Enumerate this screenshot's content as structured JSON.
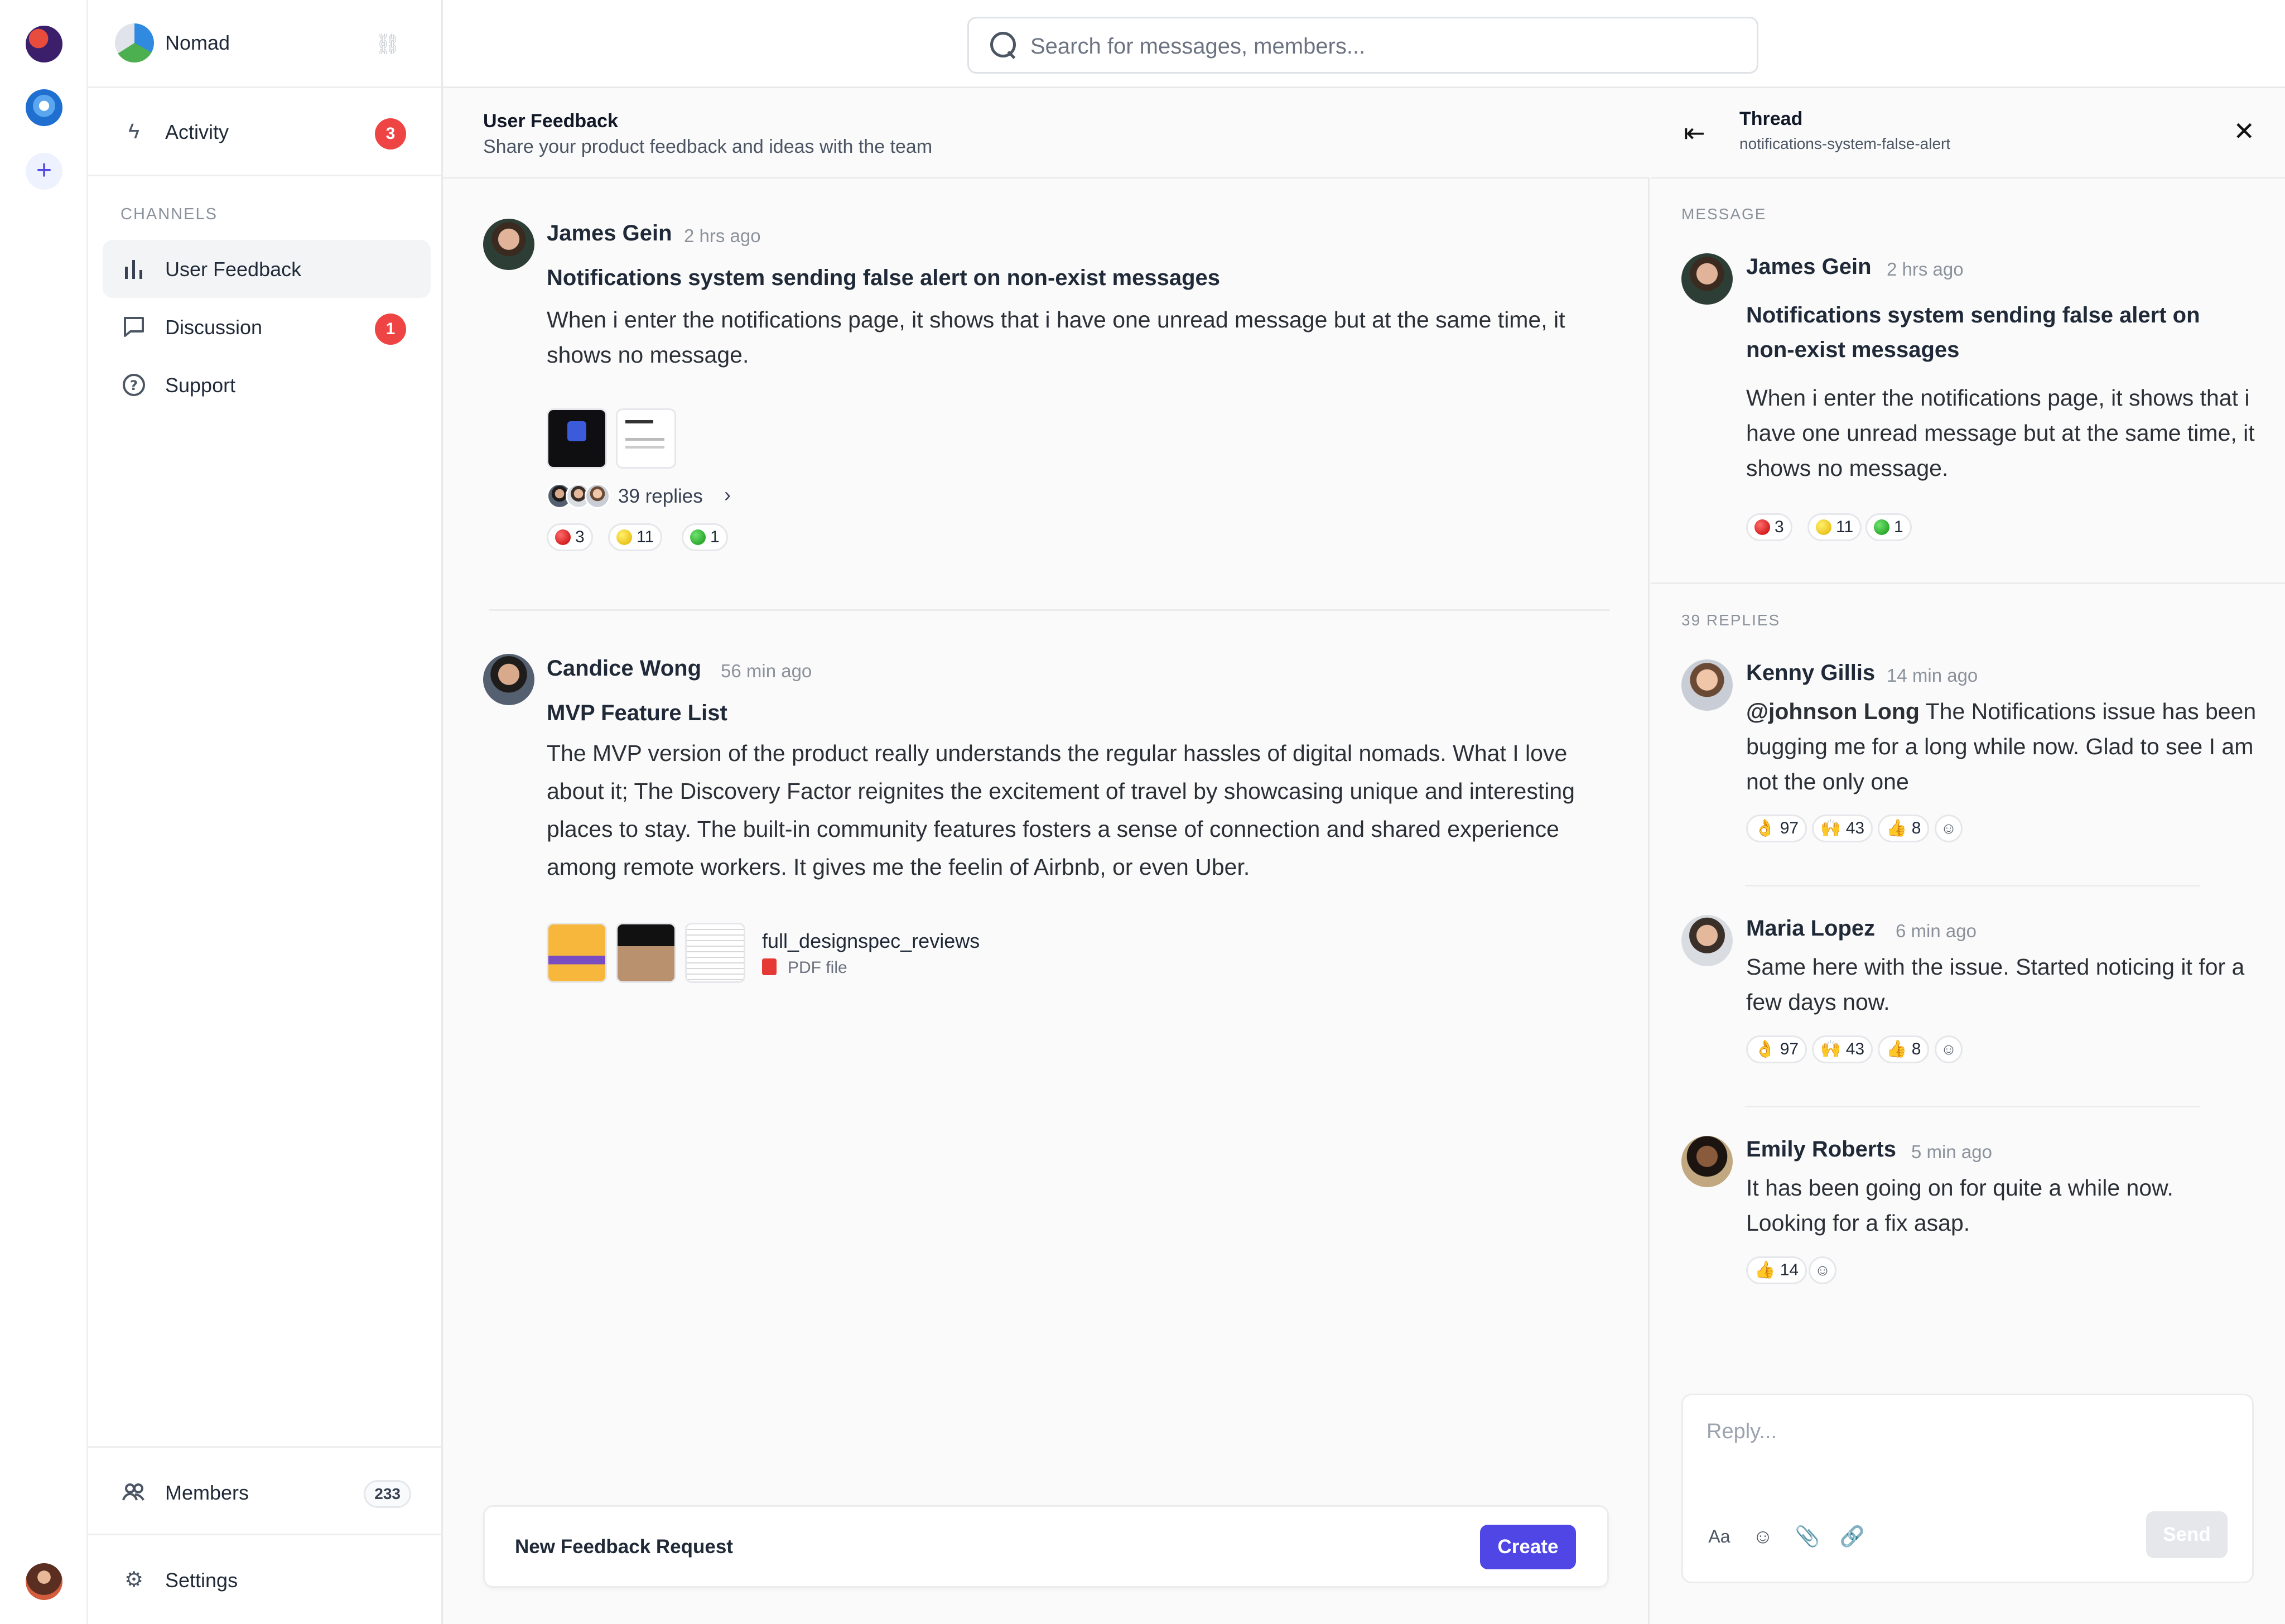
{
  "search": {
    "placeholder": "Search for messages, members..."
  },
  "org": {
    "name": "Nomad"
  },
  "nav": {
    "activity": {
      "label": "Activity",
      "badge": "3"
    },
    "channels_title": "CHANNELS",
    "channels": [
      {
        "label": "User Feedback"
      },
      {
        "label": "Discussion",
        "badge": "1"
      },
      {
        "label": "Support"
      }
    ],
    "members": {
      "label": "Members",
      "count": "233"
    },
    "settings": {
      "label": "Settings"
    }
  },
  "channel": {
    "title": "User Feedback",
    "description": "Share your product feedback and ideas with the team"
  },
  "messages": [
    {
      "author": "James Gein",
      "time": "2 hrs ago",
      "title": "Notifications system sending false alert on non-exist messages",
      "body": "When i enter the notifications page, it shows that i have one unread message but at the same time, it shows no message.",
      "replies": "39 replies",
      "reactions": [
        {
          "emoji": "red",
          "count": "3"
        },
        {
          "emoji": "yellow",
          "count": "11"
        },
        {
          "emoji": "green",
          "count": "1"
        }
      ]
    },
    {
      "author": "Candice Wong",
      "time": "56 min ago",
      "title": "MVP Feature List",
      "body": "The MVP version of the product really understands the regular hassles of digital nomads. What I love about it; The Discovery Factor reignites the excitement of travel by showcasing unique and interesting places to stay. The built-in community features fosters a sense of connection and shared experience among remote workers. It gives me the feelin of Airbnb, or even Uber.",
      "file": {
        "name": "full_designspec_reviews",
        "type": "PDF file"
      }
    }
  ],
  "composer": {
    "label": "New Feedback Request",
    "button": "Create"
  },
  "thread": {
    "title": "Thread",
    "subtitle": "notifications-system-false-alert",
    "message_label": "MESSAGE",
    "message": {
      "author": "James Gein",
      "time": "2 hrs ago",
      "title": "Notifications system sending false alert on non-exist messages",
      "body": "When i enter the notifications page, it shows that i have one unread message but at the same time, it shows no message.",
      "reactions": [
        "3",
        "11",
        "1"
      ]
    },
    "replies_label": "39 REPLIES",
    "replies": [
      {
        "author": "Kenny Gillis",
        "time": "14 min ago",
        "mention": "@johnson Long",
        "body": " The Notifications issue has been bugging me for a long while now. Glad to see I am not the only one",
        "reactions": [
          {
            "emoji": "👌",
            "count": "97"
          },
          {
            "emoji": "🙌",
            "count": "43"
          },
          {
            "emoji": "👍",
            "count": "8"
          }
        ]
      },
      {
        "author": "Maria Lopez",
        "time": "6 min ago",
        "body": "Same here with the issue. Started noticing it for a few days now.",
        "reactions": [
          {
            "emoji": "👌",
            "count": "97"
          },
          {
            "emoji": "🙌",
            "count": "43"
          },
          {
            "emoji": "👍",
            "count": "8"
          }
        ]
      },
      {
        "author": "Emily Roberts",
        "time": "5 min ago",
        "body": "It has been going on for quite a while now. Looking for a fix asap.",
        "reactions": [
          {
            "emoji": "👍",
            "count": "14"
          }
        ]
      }
    ],
    "reply_placeholder": "Reply...",
    "send_label": "Send",
    "font_tool": "Aa"
  }
}
